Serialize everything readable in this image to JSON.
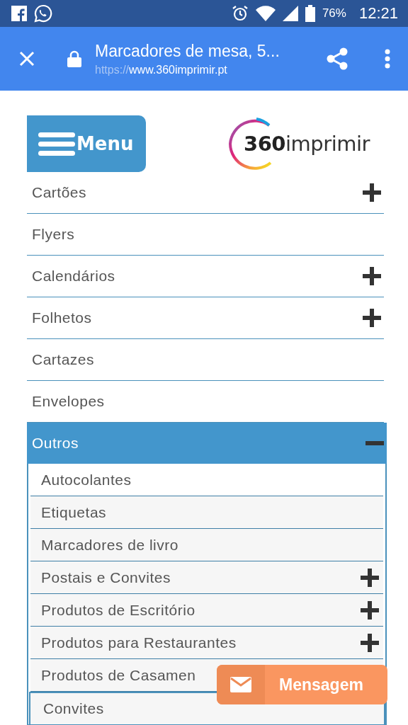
{
  "status_bar": {
    "battery": "76%",
    "time": "12:21"
  },
  "browser_bar": {
    "title": "Marcadores de mesa, 5...",
    "url_scheme": "https://",
    "url_host": "www.360imprimir.pt"
  },
  "header": {
    "menu_button": "Menu",
    "logo": {
      "bold": "360",
      "light": "imprimir"
    }
  },
  "menu": {
    "items": [
      {
        "label": "Cartões",
        "expandable": true,
        "expanded": false
      },
      {
        "label": "Flyers",
        "expandable": false,
        "expanded": false
      },
      {
        "label": "Calendários",
        "expandable": true,
        "expanded": false
      },
      {
        "label": "Folhetos",
        "expandable": true,
        "expanded": false
      },
      {
        "label": "Cartazes",
        "expandable": false,
        "expanded": false
      },
      {
        "label": "Envelopes",
        "expandable": false,
        "expanded": false
      },
      {
        "label": "Outros",
        "expandable": true,
        "expanded": true,
        "children": [
          {
            "label": "Autocolantes",
            "expandable": false
          },
          {
            "label": "Etiquetas",
            "expandable": false
          },
          {
            "label": "Marcadores de livro",
            "expandable": false
          },
          {
            "label": "Postais e Convites",
            "expandable": true
          },
          {
            "label": "Produtos de Escritório",
            "expandable": true
          },
          {
            "label": "Produtos para Restaurantes",
            "expandable": true
          },
          {
            "label": "Produtos de Casamen",
            "expandable": false,
            "children": [
              {
                "label": "Convites"
              }
            ]
          }
        ]
      }
    ]
  },
  "message_button": {
    "label": "Mensagem"
  }
}
